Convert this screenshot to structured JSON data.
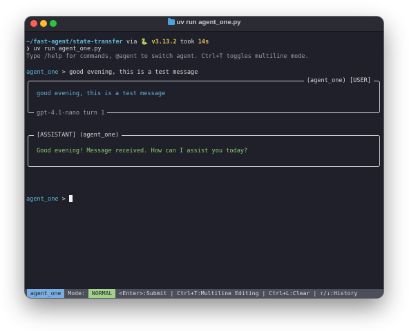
{
  "window": {
    "title": "uv run agent_one.py"
  },
  "prompt": {
    "path": "~/fast-agent/state-transfer",
    "via": " via ",
    "python_icon": "🐍",
    "python_version": " v3.13.2",
    "took": " took ",
    "duration": "14s",
    "arrow": "❯ ",
    "command": "uv run agent_one.py"
  },
  "help_text": "Type /help for commands, @agent to switch agent. Ctrl+T toggles multiline mode.",
  "user_entry": {
    "agent": "agent_one",
    "separator": " > ",
    "message": "good evening, this is a test message"
  },
  "user_panel": {
    "label": "(agent_one) [USER]",
    "message": "good evening, this is a test message",
    "footer": "gpt-4.1-nano turn 1"
  },
  "assistant_panel": {
    "label": "[ASSISTANT] (agent_one)",
    "message": "Good evening! Message received. How can I assist you today?"
  },
  "input_prompt": {
    "agent": "agent_one",
    "separator": " > "
  },
  "status_bar": {
    "agent": "agent_one",
    "mode_label": " Mode: ",
    "mode": "NORMAL",
    "hints": " <Enter>:Submit | Ctrl+T:Multiline Editing | Ctrl+L:Clear | ↑/↓:History"
  },
  "colors": {
    "background": "#1f2029",
    "cyan": "#62b6d9",
    "yellow": "#e5c15b",
    "green": "#8bc977",
    "status_bar": "#4c4f59"
  }
}
